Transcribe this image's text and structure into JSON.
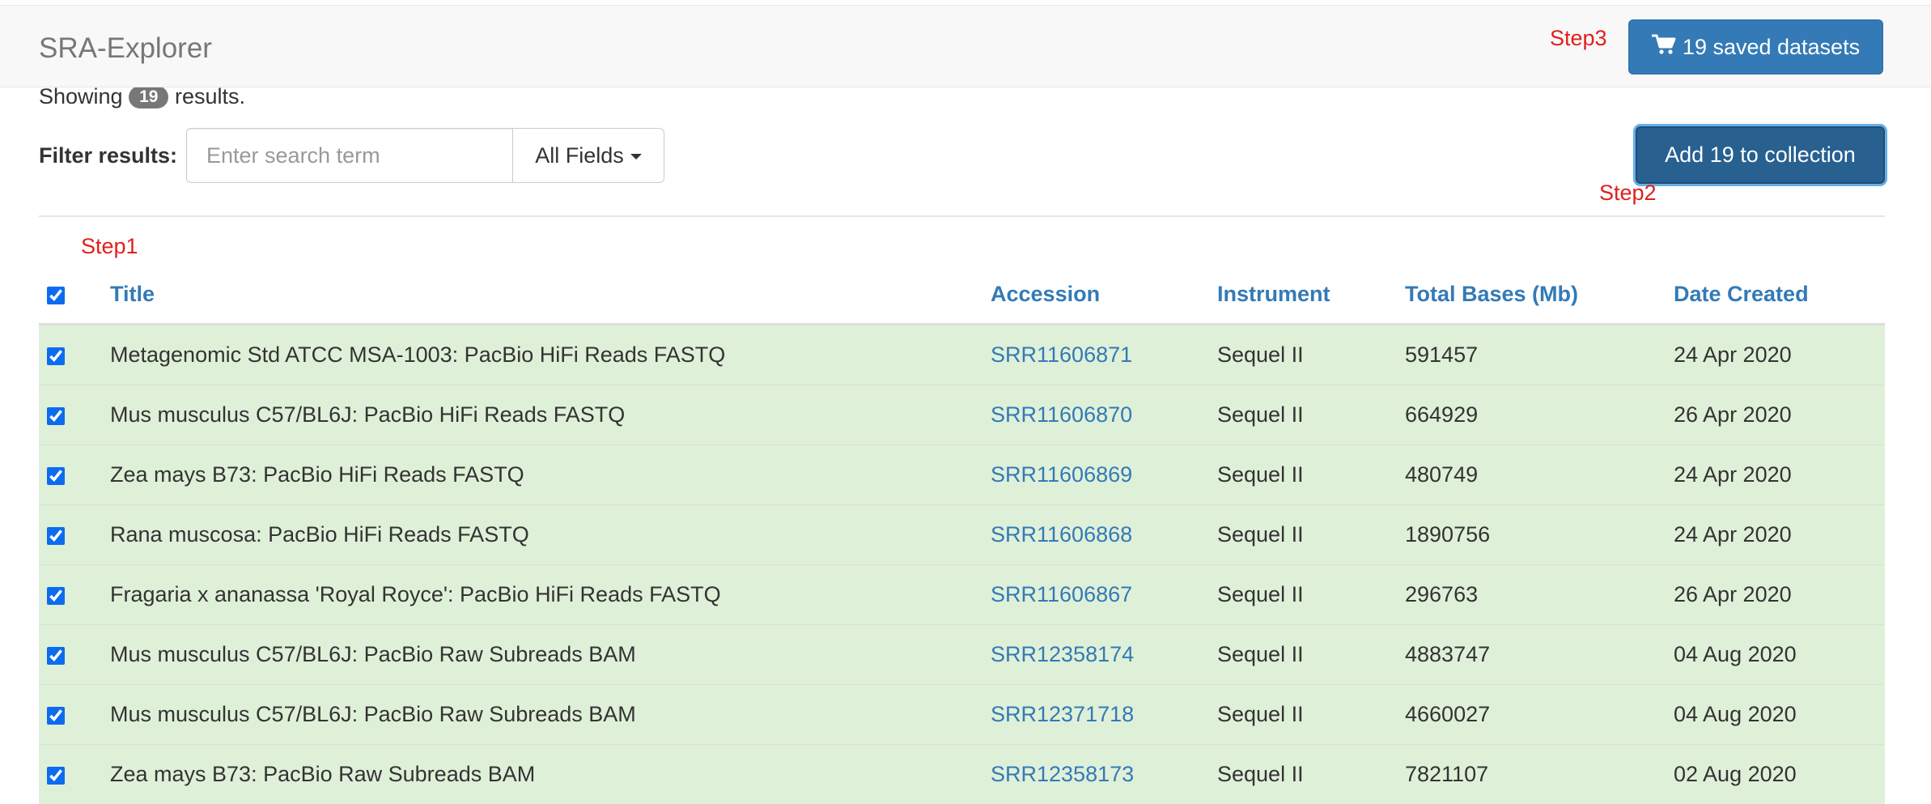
{
  "app": {
    "brand": "SRA-Explorer"
  },
  "annotations": {
    "step1": "Step1",
    "step2": "Step2",
    "step3": "Step3",
    "color": "#e0201c"
  },
  "header": {
    "saved_button_label": "19 saved datasets",
    "cart_icon": "shopping-cart-icon"
  },
  "summary": {
    "prefix": "Showing",
    "count": "19",
    "suffix": "results."
  },
  "filter": {
    "label": "Filter results:",
    "placeholder": "Enter search term",
    "value": "",
    "field_select": "All Fields"
  },
  "actions": {
    "add_button_label": "Add 19 to collection"
  },
  "table": {
    "columns": [
      "Title",
      "Accession",
      "Instrument",
      "Total Bases (Mb)",
      "Date Created"
    ],
    "select_all_checked": true,
    "rows": [
      {
        "title": "Metagenomic Std ATCC MSA-1003: PacBio HiFi Reads FASTQ",
        "accession": "SRR11606871",
        "instrument": "Sequel II",
        "bases": "591457",
        "date": "24 Apr 2020",
        "checked": true
      },
      {
        "title": "Mus musculus C57/BL6J: PacBio HiFi Reads FASTQ",
        "accession": "SRR11606870",
        "instrument": "Sequel II",
        "bases": "664929",
        "date": "26 Apr 2020",
        "checked": true
      },
      {
        "title": "Zea mays B73: PacBio HiFi Reads FASTQ",
        "accession": "SRR11606869",
        "instrument": "Sequel II",
        "bases": "480749",
        "date": "24 Apr 2020",
        "checked": true
      },
      {
        "title": "Rana muscosa: PacBio HiFi Reads FASTQ",
        "accession": "SRR11606868",
        "instrument": "Sequel II",
        "bases": "1890756",
        "date": "24 Apr 2020",
        "checked": true
      },
      {
        "title": "Fragaria x ananassa 'Royal Royce': PacBio HiFi Reads FASTQ",
        "accession": "SRR11606867",
        "instrument": "Sequel II",
        "bases": "296763",
        "date": "26 Apr 2020",
        "checked": true
      },
      {
        "title": "Mus musculus C57/BL6J: PacBio Raw Subreads BAM",
        "accession": "SRR12358174",
        "instrument": "Sequel II",
        "bases": "4883747",
        "date": "04 Aug 2020",
        "checked": true
      },
      {
        "title": "Mus musculus C57/BL6J: PacBio Raw Subreads BAM",
        "accession": "SRR12371718",
        "instrument": "Sequel II",
        "bases": "4660027",
        "date": "04 Aug 2020",
        "checked": true
      },
      {
        "title": "Zea mays B73: PacBio Raw Subreads BAM",
        "accession": "SRR12358173",
        "instrument": "Sequel II",
        "bases": "7821107",
        "date": "02 Aug 2020",
        "checked": true
      }
    ]
  }
}
